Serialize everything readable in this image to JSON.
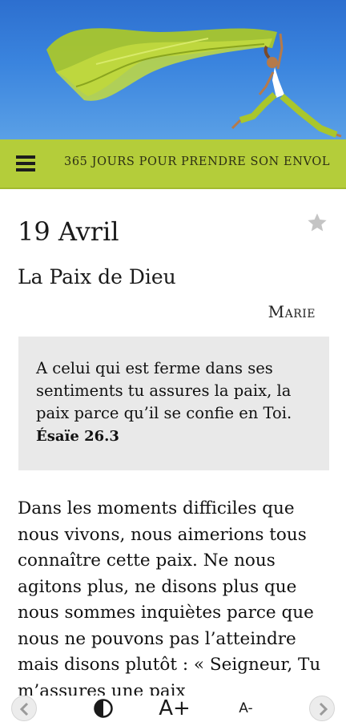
{
  "header": {
    "title": "365 JOURS POUR PRENDRE SON ENVOL"
  },
  "entry": {
    "date": "19 Avril",
    "title": "La Paix de Dieu",
    "author": "Marie",
    "verse_text": "A celui qui est ferme dans ses sentiments tu assures la paix, la paix parce qu’il se confie en Toi.",
    "verse_ref": "Ésaïe 26.3",
    "body": "Dans les moments difficiles que nous vivons, nous aimerions tous connaître cette paix. Ne nous agitons plus, ne disons plus que nous sommes inquiètes parce que nous ne pouvons pas l’atteindre mais disons plutôt : « Seigneur, Tu m’assures une paix"
  },
  "toolbar": {
    "increase_font": "A+",
    "decrease_font": "A-"
  },
  "colors": {
    "accent": "#b4cd3a",
    "sky": "#3a84de",
    "verse_bg": "#e9e9e9"
  },
  "icons": [
    "menu-icon",
    "star-icon",
    "chevron-left-icon",
    "contrast-icon",
    "chevron-right-icon"
  ]
}
